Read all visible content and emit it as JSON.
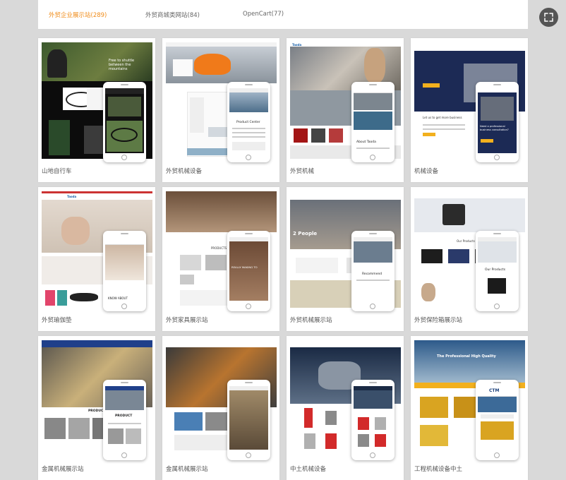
{
  "tabs": [
    {
      "label": "外贸企业展示站(289)",
      "active": true
    },
    {
      "label": "外贸商城类网站(84)",
      "active": false
    },
    {
      "label": "OpenCart(77)",
      "active": false
    }
  ],
  "toolbar": {
    "zoom_icon": "zoom-icon"
  },
  "cards": [
    {
      "caption": "山地自行车",
      "thumb_text": "Free to shuttle between the mountains",
      "phone_text": ""
    },
    {
      "caption": "外贸机械设备",
      "thumb_text": "",
      "phone_text": "Product Center"
    },
    {
      "caption": "外贸机械",
      "thumb_text": "Taoda",
      "phone_text": "About Taoda"
    },
    {
      "caption": "机械设备",
      "thumb_text": "Let us to get more business",
      "phone_text": "Need a professional business consultation?"
    },
    {
      "caption": "外贸瑜伽垫",
      "thumb_text": "Taoda",
      "phone_text": "KNOW ABOUT"
    },
    {
      "caption": "外贸家具展示站",
      "thumb_text": "PRODUCTS CATEGORY",
      "phone_text": "REALLY MAKING TO"
    },
    {
      "caption": "外贸机械展示站",
      "thumb_text": "2 People",
      "phone_text": "Recommend"
    },
    {
      "caption": "外贸保险箱展示站",
      "thumb_text": "Our Products",
      "phone_text": "Our Products"
    },
    {
      "caption": "金属机械展示站",
      "thumb_text": "PRODUCT",
      "phone_text": "PRODUCT"
    },
    {
      "caption": "金属机械展示站",
      "thumb_text": "",
      "phone_text": ""
    },
    {
      "caption": "中土机械设备",
      "thumb_text": "",
      "phone_text": ""
    },
    {
      "caption": "工程机械设备中土",
      "thumb_text": "The Professional High Quality",
      "phone_text": "CTM"
    }
  ]
}
